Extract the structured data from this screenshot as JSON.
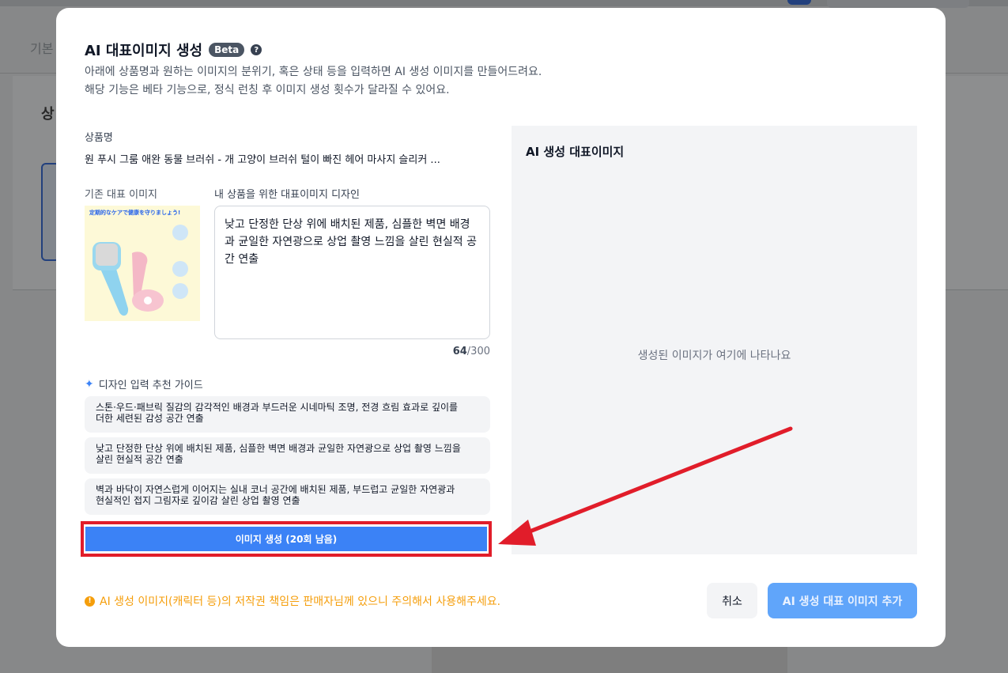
{
  "modal": {
    "title": "AI 대표이미지 생성",
    "beta_badge": "Beta",
    "help_icon": "?",
    "description_line1": "아래에 상품명과 원하는 이미지의 분위기, 혹은 상태 등을 입력하면 AI 생성 이미지를 만들어드려요.",
    "description_line2": "해당 기능은 베타 기능으로, 정식 런칭 후 이미지 생성 횟수가 달라질 수 있어요."
  },
  "form": {
    "product_name_label": "상품명",
    "product_name_value": "원 푸시 그룸 애완 동물 브러쉬 - 개 고양이 브러쉬 털이 빠진 헤어 마사지 슬리커 ...",
    "existing_image_label": "기존 대표 이미지",
    "design_label": "내 상품을 위한 대표이미지 디자인",
    "design_value": "낮고 단정한 단상 위에 배치된 제품, 심플한 벽면 배경과 균일한 자연광으로 상업 촬영 느낌을 살린 현실적 공간 연출",
    "char_count": "64",
    "char_max": "/300",
    "thumbnail_banner": "定期的なケアで健康を守りましょう!"
  },
  "guide": {
    "title": "디자인 입력 추천 가이드",
    "items": [
      {
        "line1": "스톤·우드·패브릭 질감의 감각적인 배경과 부드러운 시네마틱 조명, 전경 흐림 효과로 깊이를",
        "line2": "더한 세련된 감성 공간 연출"
      },
      {
        "line1": "낮고 단정한 단상 위에 배치된 제품, 심플한 벽면 배경과 균일한 자연광으로 상업 촬영 느낌을",
        "line2": "살린 현실적 공간 연출"
      },
      {
        "line1": "벽과 바닥이 자연스럽게 이어지는 실내 코너 공간에 배치된 제품, 부드럽고 균일한 자연광과",
        "line2": "현실적인 접지 그림자로 깊이감 살린 상업 촬영 연출"
      }
    ]
  },
  "generate_button": "이미지 생성 (20회 남음)",
  "preview": {
    "title": "AI 생성 대표이미지",
    "placeholder": "생성된 이미지가 여기에 나타나요"
  },
  "footer": {
    "notice": "AI 생성 이미지(캐릭터 등)의 저작권 책임은 판매자님께 있으니 주의해서 사용해주세요.",
    "cancel": "취소",
    "add": "AI 생성 대표 이미지 추가"
  },
  "background": {
    "tab": "기본",
    "title": "상"
  },
  "colors": {
    "accent": "#3b82f6",
    "highlight": "#e11d2a",
    "warning": "#f59e0b"
  },
  "icons": [
    "help-icon",
    "sparkle-icon",
    "warning-icon",
    "annotation-arrow"
  ]
}
